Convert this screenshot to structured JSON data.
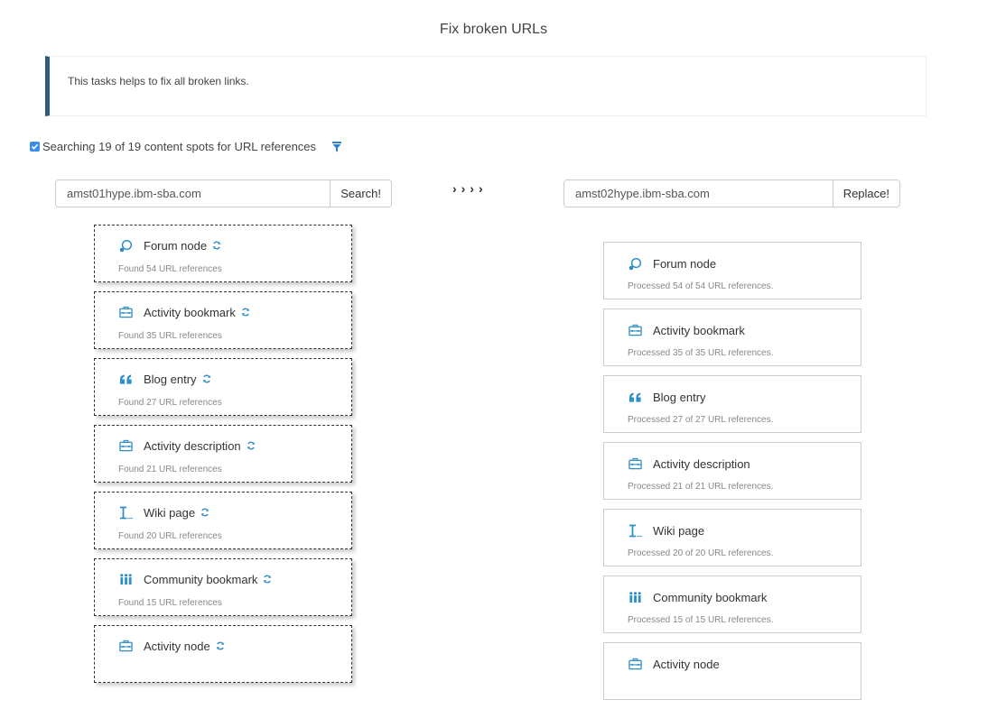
{
  "page": {
    "title": "Fix broken URLs",
    "info": "This tasks helps to fix all broken links."
  },
  "scope": {
    "checked": true,
    "label": "Searching 19 of 19 content spots for URL references",
    "filter_icon": "filter-icon"
  },
  "search": {
    "value": "amst01hype.ibm-sba.com",
    "button": "Search!"
  },
  "arrows": "››››",
  "replace": {
    "value": "amst02hype.ibm-sba.com",
    "button": "Replace!"
  },
  "accent_color": "#2e8fc8",
  "found": [
    {
      "icon": "forum-icon",
      "name": "Forum node",
      "status": "Found 54 URL references"
    },
    {
      "icon": "briefcase-icon",
      "name": "Activity bookmark",
      "status": "Found 35 URL references"
    },
    {
      "icon": "quote-icon",
      "name": "Blog entry",
      "status": "Found 27 URL references"
    },
    {
      "icon": "briefcase-icon",
      "name": "Activity description",
      "status": "Found 21 URL references"
    },
    {
      "icon": "wiki-icon",
      "name": "Wiki page",
      "status": "Found 20 URL references"
    },
    {
      "icon": "community-icon",
      "name": "Community bookmark",
      "status": "Found 15 URL references"
    },
    {
      "icon": "briefcase-icon",
      "name": "Activity node",
      "status": ""
    }
  ],
  "processed": [
    {
      "icon": "forum-icon",
      "name": "Forum node",
      "status": "Processed 54 of 54 URL references."
    },
    {
      "icon": "briefcase-icon",
      "name": "Activity bookmark",
      "status": "Processed 35 of 35 URL references."
    },
    {
      "icon": "quote-icon",
      "name": "Blog entry",
      "status": "Processed 27 of 27 URL references."
    },
    {
      "icon": "briefcase-icon",
      "name": "Activity description",
      "status": "Processed 21 of 21 URL references."
    },
    {
      "icon": "wiki-icon",
      "name": "Wiki page",
      "status": "Processed 20 of 20 URL references."
    },
    {
      "icon": "community-icon",
      "name": "Community bookmark",
      "status": "Processed 15 of 15 URL references."
    },
    {
      "icon": "briefcase-icon",
      "name": "Activity node",
      "status": ""
    }
  ]
}
